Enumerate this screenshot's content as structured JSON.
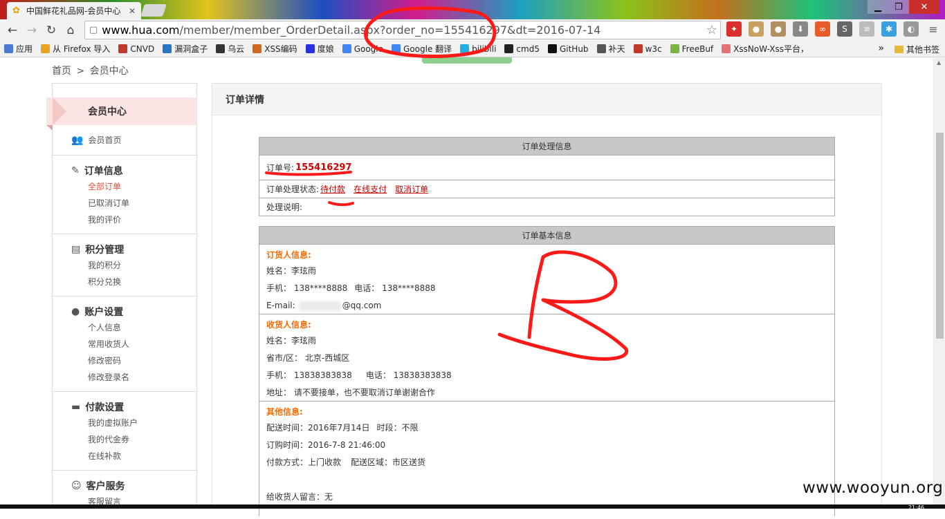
{
  "browser": {
    "tab_title": "中国鲜花礼品网-会员中心",
    "url_host": "www.hua.com",
    "url_path": "/member/member_OrderDetail.aspx?order_no=155416297&dt=2016-07-14",
    "bookmarks": [
      {
        "label": "应用",
        "color": "#4a7bd0"
      },
      {
        "label": "从 Firefox 导入",
        "color": "#e8a320"
      },
      {
        "label": "CNVD",
        "color": "#c0392b"
      },
      {
        "label": "漏洞盒子",
        "color": "#2a74c9"
      },
      {
        "label": "乌云",
        "color": "#333333"
      },
      {
        "label": "XSS编码",
        "color": "#d2691e"
      },
      {
        "label": "度娘",
        "color": "#2932e1"
      },
      {
        "label": "Google",
        "color": "#4285f4"
      },
      {
        "label": "Google 翻译",
        "color": "#4285f4"
      },
      {
        "label": "bilibili",
        "color": "#23ade5"
      },
      {
        "label": "cmd5",
        "color": "#222222"
      },
      {
        "label": "GitHub",
        "color": "#111111"
      },
      {
        "label": "补天",
        "color": "#555555"
      },
      {
        "label": "w3c",
        "color": "#c0392b"
      },
      {
        "label": "FreeBuf",
        "color": "#7cb342"
      },
      {
        "label": "XssNoW-Xss平台，",
        "color": "#e57373"
      }
    ],
    "other_bookmarks": "其他书签"
  },
  "breadcrumb": {
    "home": "首页",
    "sep": ">",
    "current": "会员中心"
  },
  "sidebar": {
    "head": "会员中心",
    "home": "会员首页",
    "sections": [
      {
        "title": "订单信息",
        "icon": "edit-icon",
        "items": [
          "全部订单",
          "已取消订单",
          "我的评价"
        ]
      },
      {
        "title": "积分管理",
        "icon": "card-icon",
        "items": [
          "我的积分",
          "积分兑换"
        ]
      },
      {
        "title": "账户设置",
        "icon": "account-icon",
        "items": [
          "个人信息",
          "常用收货人",
          "修改密码",
          "修改登录名"
        ]
      },
      {
        "title": "付款设置",
        "icon": "payment-icon",
        "items": [
          "我的虚拟账户",
          "我的代金券",
          "在线补款"
        ]
      },
      {
        "title": "客户服务",
        "icon": "service-icon",
        "items": [
          "客服留言"
        ]
      }
    ]
  },
  "main": {
    "heading": "订单详情",
    "process": {
      "caption": "订单处理信息",
      "order_no_label": "订单号:",
      "order_no": "155416297",
      "status_label": "订单处理状态:",
      "status_value": "待付款",
      "pay_link": "在线支付",
      "cancel_link": "取消订单",
      "note_label": "处理说明:"
    },
    "basic": {
      "caption": "订单基本信息",
      "buyer_title": "订货人信息:",
      "buyer_name": "姓名：李玹雨",
      "buyer_mobile": "手机： 138****8888",
      "buyer_phone": "电话： 138****8888",
      "buyer_email_label": "E-mail:",
      "buyer_email_suffix": "@qq.com",
      "receiver_title": "收货人信息:",
      "receiver_name": "姓名：李玹雨",
      "receiver_region": "省市/区： 北京-西城区",
      "receiver_mobile": "手机： 13838383838",
      "receiver_phone": "电话： 13838383838",
      "receiver_address": "地址： 请不要接单，也不要取消订单谢谢合作",
      "other_title": "其他信息:",
      "delivery_time": "配送时间：2016年7月14日",
      "time_slot": "时段：不限",
      "order_time": "订购时间：2016-7-8 21:46:00",
      "pay_method": "付款方式：上门收款",
      "delivery_area": "配送区域：市区送货",
      "message": "给收货人留言：无"
    }
  },
  "watermark": "www.wooyun.org",
  "clock": "21:46",
  "colors": {
    "accent_red": "#d40000",
    "orange_title": "#ff6a00",
    "annotation": "#ff0000"
  }
}
